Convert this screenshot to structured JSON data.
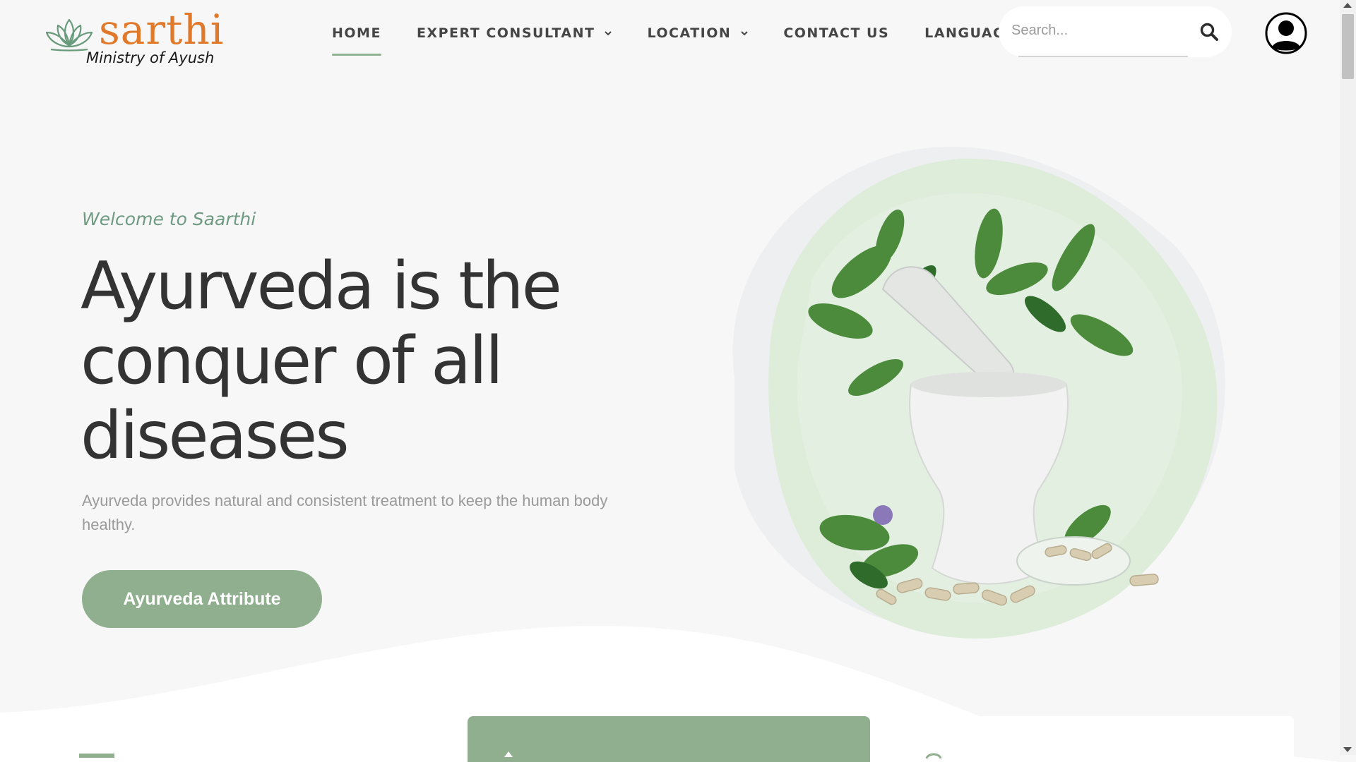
{
  "brand": {
    "name": "sarthi",
    "subtitle": "Ministry of Ayush",
    "accent_color": "#e07a2a",
    "icon": "lotus-icon"
  },
  "nav": {
    "items": [
      {
        "label": "HOME",
        "active": true,
        "dropdown": false
      },
      {
        "label": "EXPERT CONSULTANT",
        "active": false,
        "dropdown": true
      },
      {
        "label": "LOCATION",
        "active": false,
        "dropdown": true
      },
      {
        "label": "CONTACT US",
        "active": false,
        "dropdown": false
      },
      {
        "label": "LANGUAGE",
        "active": false,
        "dropdown": true
      }
    ],
    "dropdown_icon": "chevron-down-icon"
  },
  "search": {
    "placeholder": "Search...",
    "value": "",
    "icon": "search-icon"
  },
  "account": {
    "icon": "user-avatar-icon"
  },
  "hero": {
    "welcome": "Welcome to Saarthi",
    "title": "Ayurveda is the conquer of all diseases",
    "description": "Ayurveda provides natural and consistent treatment to keep the human body healthy.",
    "button_label": "Ayurveda Attribute",
    "image_subject": "mortar-and-pestle-with-herbs-and-capsules"
  },
  "colors": {
    "primary_green": "#8faf8f",
    "welcome_text": "#6f9a82",
    "background": "#f7f7f7"
  },
  "cards": [
    {
      "highlighted": false
    },
    {
      "highlighted": true
    },
    {
      "highlighted": false
    }
  ]
}
